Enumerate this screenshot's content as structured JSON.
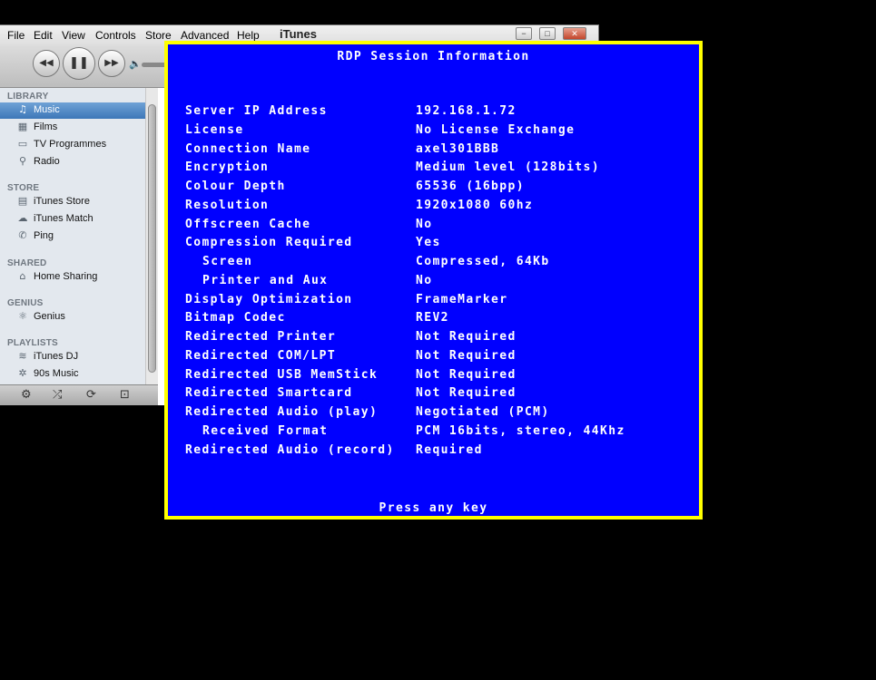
{
  "itunes": {
    "title": "iTunes",
    "menu": [
      "File",
      "Edit",
      "View",
      "Controls",
      "Store",
      "Advanced",
      "Help"
    ],
    "window_controls": {
      "minimize": "−",
      "restore": "□",
      "close": "✕"
    },
    "sidebar": {
      "sections": [
        {
          "heading": "LIBRARY",
          "items": [
            {
              "label": "Music",
              "icon": "music-note-icon",
              "glyph": "♫",
              "selected": true
            },
            {
              "label": "Films",
              "icon": "film-icon",
              "glyph": "▦"
            },
            {
              "label": "TV Programmes",
              "icon": "tv-icon",
              "glyph": "▭"
            },
            {
              "label": "Radio",
              "icon": "radio-icon",
              "glyph": "⚲"
            }
          ]
        },
        {
          "heading": "STORE",
          "items": [
            {
              "label": "iTunes Store",
              "icon": "store-icon",
              "glyph": "▤"
            },
            {
              "label": "iTunes Match",
              "icon": "cloud-icon",
              "glyph": "☁"
            },
            {
              "label": "Ping",
              "icon": "ping-icon",
              "glyph": "✆"
            }
          ]
        },
        {
          "heading": "SHARED",
          "items": [
            {
              "label": "Home Sharing",
              "icon": "home-icon",
              "glyph": "⌂"
            }
          ]
        },
        {
          "heading": "GENIUS",
          "items": [
            {
              "label": "Genius",
              "icon": "genius-icon",
              "glyph": "⚛"
            }
          ]
        },
        {
          "heading": "PLAYLISTS",
          "items": [
            {
              "label": "iTunes DJ",
              "icon": "dj-icon",
              "glyph": "≋"
            },
            {
              "label": "90s Music",
              "icon": "gear-playlist-icon",
              "glyph": "✲"
            }
          ]
        }
      ]
    },
    "bottom_icons": [
      {
        "name": "settings-gear-icon",
        "glyph": "⚙"
      },
      {
        "name": "shuffle-icon",
        "glyph": "⤮"
      },
      {
        "name": "repeat-icon",
        "glyph": "⟳"
      },
      {
        "name": "display-artwork-icon",
        "glyph": "⊡"
      }
    ],
    "controls": {
      "prev": "◀◀",
      "pause": "❚❚",
      "next": "▶▶",
      "volume": "🔈"
    }
  },
  "rdp": {
    "title": "RDP Session Information",
    "rows": [
      {
        "key": "Server IP Address",
        "value": "192.168.1.72"
      },
      {
        "key": "License",
        "value": "No License Exchange"
      },
      {
        "key": "Connection Name",
        "value": "axel301BBB"
      },
      {
        "key": "Encryption",
        "value": "Medium level (128bits)"
      },
      {
        "key": "Colour Depth",
        "value": "65536 (16bpp)"
      },
      {
        "key": "Resolution",
        "value": "1920x1080 60hz"
      },
      {
        "key": "Offscreen Cache",
        "value": "No"
      },
      {
        "key": "Compression Required",
        "value": "Yes"
      },
      {
        "key": "Screen",
        "value": "Compressed, 64Kb",
        "sub": true
      },
      {
        "key": "Printer and Aux",
        "value": "No",
        "sub": true
      },
      {
        "key": "Display Optimization",
        "value": "FrameMarker"
      },
      {
        "key": "Bitmap Codec",
        "value": "REV2"
      },
      {
        "key": "Redirected Printer",
        "value": "Not Required"
      },
      {
        "key": "Redirected COM/LPT",
        "value": "Not Required"
      },
      {
        "key": "Redirected USB MemStick",
        "value": "Not Required"
      },
      {
        "key": "Redirected Smartcard",
        "value": "Not Required"
      },
      {
        "key": "Redirected Audio (play)",
        "value": "Negotiated (PCM)"
      },
      {
        "key": "Received Format",
        "value": "PCM 16bits, stereo, 44Khz",
        "sub": true
      },
      {
        "key": "Redirected Audio (record)",
        "value": "Required"
      }
    ],
    "footer": "Press any key",
    "colors": {
      "background": "#0000ff",
      "border": "#ffff00",
      "text": "#ffffff"
    }
  }
}
